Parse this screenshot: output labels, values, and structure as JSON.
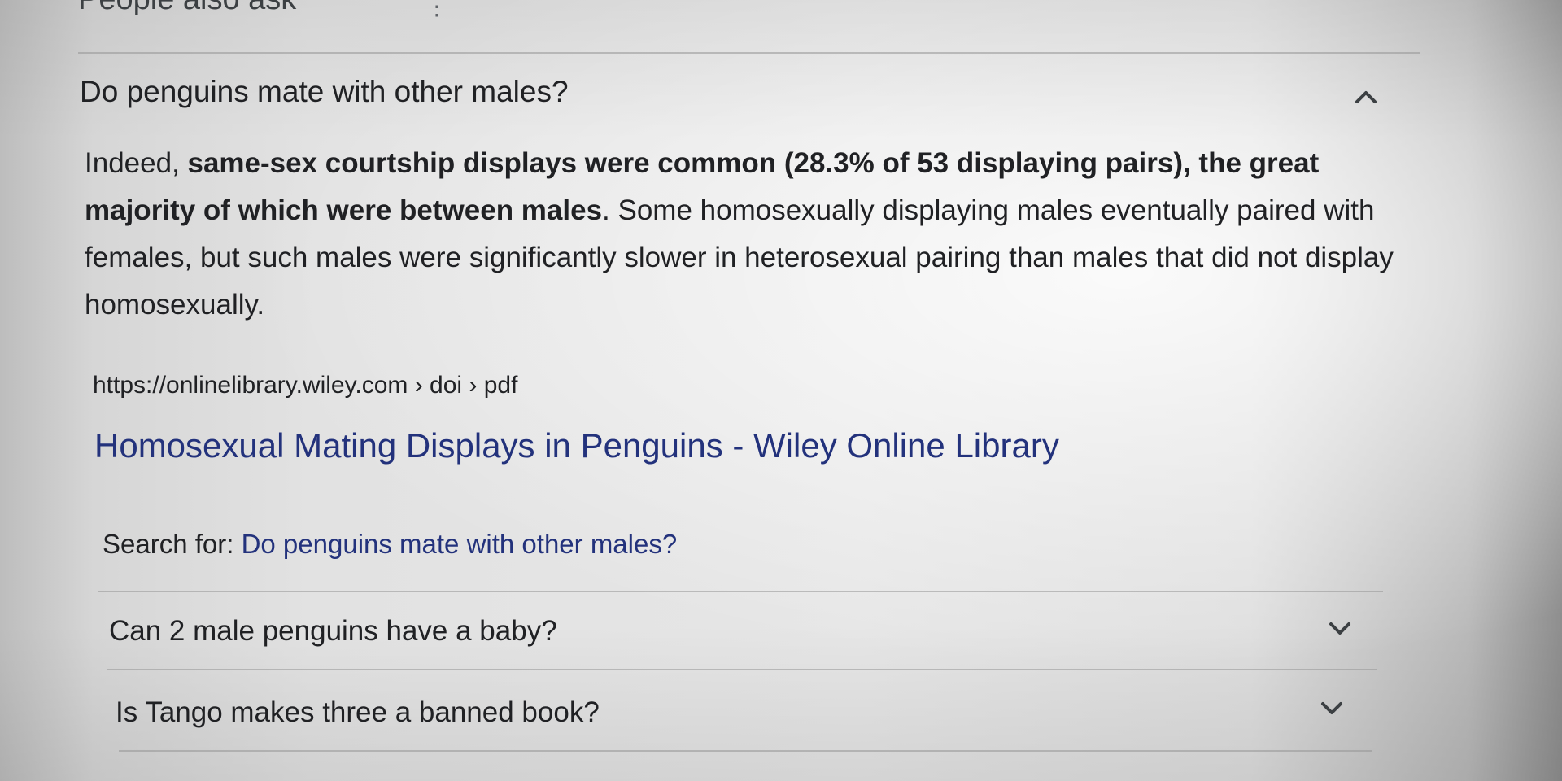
{
  "paa": {
    "header": "People also ask",
    "menu_icon": "more-vert-icon"
  },
  "expanded": {
    "question": "Do penguins mate with other males?",
    "chevron_icon": "chevron-up-icon",
    "answer": {
      "intro": "Indeed, ",
      "bold": "same-sex courtship displays were common (28.3% of 53 displaying pairs), the great majority of which were between males",
      "rest": ". Some homosexually displaying males eventually paired with females, but such males were significantly slower in heterosexual pairing than males that did not display homosexually."
    },
    "source_url": "https://onlinelibrary.wiley.com › doi › pdf",
    "source_title": "Homosexual Mating Displays in Penguins - Wiley Online Library",
    "search_for_label": "Search for: ",
    "search_for_query": "Do penguins mate with other males?"
  },
  "questions": [
    {
      "text": "Can 2 male penguins have a baby?",
      "chevron_icon": "chevron-down-icon"
    },
    {
      "text": "Is Tango makes three a banned book?",
      "chevron_icon": "chevron-down-icon"
    }
  ],
  "colors": {
    "link": "#23327c",
    "text": "#202124",
    "divider": "#969696"
  }
}
